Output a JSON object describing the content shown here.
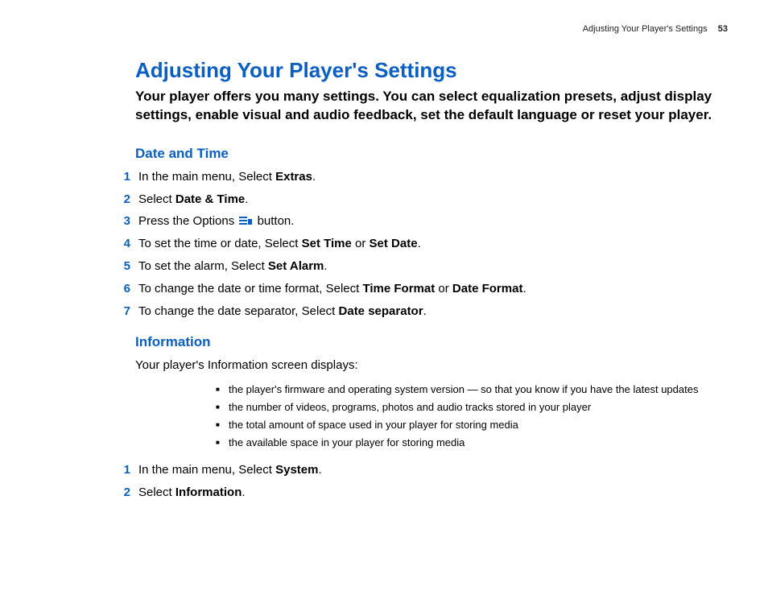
{
  "header": {
    "running_title": "Adjusting Your Player's Settings",
    "page_number": "53"
  },
  "title": "Adjusting Your Player's Settings",
  "intro": "Your player offers you many settings. You can select equalization presets, adjust display settings, enable visual and audio feedback, set the default language or reset your player.",
  "sections": {
    "date_time": {
      "heading": "Date and Time",
      "steps": [
        {
          "num": "1",
          "pre": "In the main menu, Select ",
          "b1": "Extras",
          "post": "."
        },
        {
          "num": "2",
          "pre": "Select ",
          "b1": "Date & Time",
          "post": "."
        },
        {
          "num": "3",
          "pre": "Press the Options ",
          "icon": true,
          "post": " button."
        },
        {
          "num": "4",
          "pre": "To set the time or date, Select ",
          "b1": "Set Time",
          "mid": " or ",
          "b2": "Set Date",
          "post": "."
        },
        {
          "num": "5",
          "pre": "To set the alarm, Select ",
          "b1": "Set Alarm",
          "post": "."
        },
        {
          "num": "6",
          "pre": "To change the date or time format, Select ",
          "b1": "Time Format",
          "mid": " or ",
          "b2": "Date Format",
          "post": "."
        },
        {
          "num": "7",
          "pre": "To change the date separator, Select ",
          "b1": "Date separator",
          "post": "."
        }
      ]
    },
    "information": {
      "heading": "Information",
      "lead": "Your player's Information screen displays:",
      "bullets": [
        "the player's firmware and operating system version — so that you know if you have the latest updates",
        "the number of videos, programs, photos and audio tracks stored in your player",
        "the total amount of space used in your player for storing media",
        "the available space in your player for storing media"
      ],
      "steps": [
        {
          "num": "1",
          "pre": "In the main menu, Select ",
          "b1": "System",
          "post": "."
        },
        {
          "num": "2",
          "pre": "Select ",
          "b1": "Information",
          "post": "."
        }
      ]
    }
  }
}
